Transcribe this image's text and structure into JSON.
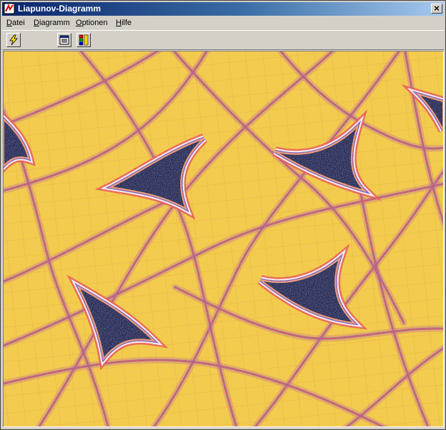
{
  "window": {
    "title": "Liapunov-Diagramm",
    "close_label": "×"
  },
  "menu": {
    "items": [
      {
        "label": "Datei",
        "accel": "D",
        "rest": "atei"
      },
      {
        "label": "Diagramm",
        "accel": "D",
        "rest": "iagramm"
      },
      {
        "label": "Optionen",
        "accel": "O",
        "rest": "ptionen"
      },
      {
        "label": "Hilfe",
        "accel": "H",
        "rest": "ilfe"
      }
    ]
  },
  "toolbar": {
    "icons": [
      "lightning-icon",
      "document-list-icon",
      "color-palette-icon"
    ]
  },
  "colors": {
    "background": "#f5d03a",
    "stable_dark": "#1c2a55",
    "band_red": "#e8504a",
    "band_orange": "#f09a6a",
    "band_blue": "#6f5ab8",
    "band_white": "#ffffff",
    "speckle": "#c46a8a"
  }
}
